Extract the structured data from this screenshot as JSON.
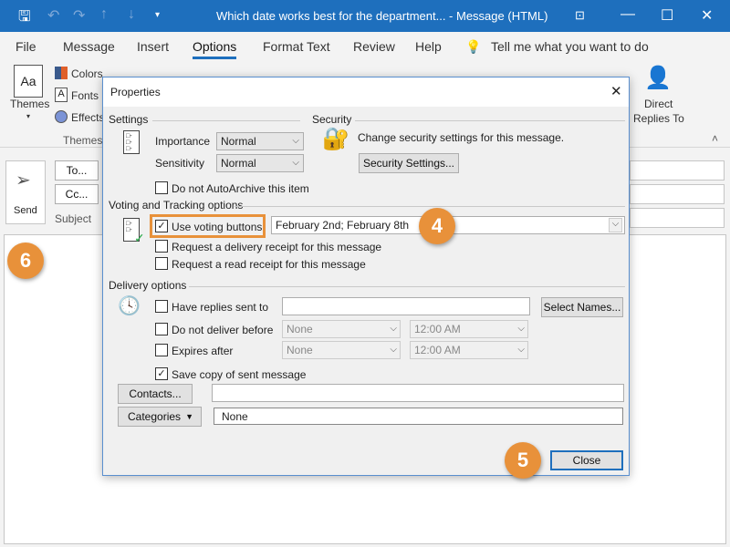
{
  "window": {
    "title": "Which date works best for the department... - Message (HTML)"
  },
  "menu": {
    "items": [
      "File",
      "Message",
      "Insert",
      "Options",
      "Format Text",
      "Review",
      "Help"
    ],
    "active": "Options",
    "tell_me": "Tell me what you want to do"
  },
  "ribbon": {
    "themes": "Themes",
    "colors": "Colors",
    "fonts": "Fonts",
    "effects": "Effects",
    "group_themes": "Themes",
    "direct_replies": "Direct",
    "direct_replies2": "Replies To"
  },
  "compose": {
    "send": "Send",
    "to": "To...",
    "cc": "Cc...",
    "subject": "Subject"
  },
  "dialog": {
    "title": "Properties",
    "settings": {
      "heading": "Settings",
      "importance_label": "Importance",
      "importance": "Normal",
      "sensitivity_label": "Sensitivity",
      "sensitivity": "Normal",
      "autoarchive": "Do not AutoArchive this item"
    },
    "security": {
      "heading": "Security",
      "text": "Change security settings for this message.",
      "button": "Security Settings..."
    },
    "voting": {
      "heading": "Voting and Tracking options",
      "use_voting": "Use voting buttons",
      "voting_value": "February 2nd; February 8th",
      "delivery_receipt": "Request a delivery receipt for this message",
      "read_receipt": "Request a read receipt for this message"
    },
    "delivery": {
      "heading": "Delivery options",
      "replies_to": "Have replies sent to",
      "select_names": "Select Names...",
      "not_before": "Do not deliver before",
      "expires": "Expires after",
      "date_none": "None",
      "time": "12:00 AM",
      "save_copy": "Save copy of sent message",
      "contacts": "Contacts...",
      "categories": "Categories",
      "categories_value": "None"
    },
    "close": "Close"
  },
  "callouts": {
    "step4": "4",
    "step5": "5",
    "step6": "6"
  },
  "colors": {
    "accent": "#1e6fbd",
    "callout": "#e8913a"
  }
}
